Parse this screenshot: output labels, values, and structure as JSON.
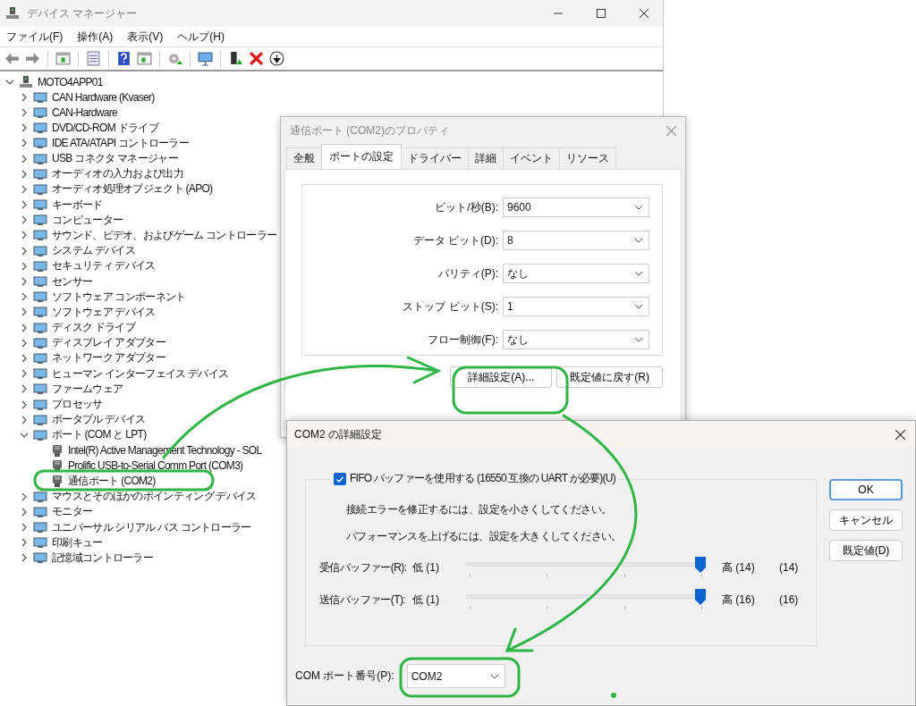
{
  "device_manager": {
    "title": "デバイス マネージャー",
    "menu": [
      "ファイル(F)",
      "操作(A)",
      "表示(V)",
      "ヘルプ(H)"
    ],
    "tree": {
      "label": "MOTO4APP01",
      "expanded": true,
      "children": [
        {
          "label": "CAN Hardware (Kvaser)",
          "expanded": false
        },
        {
          "label": "CAN-Hardware",
          "expanded": false
        },
        {
          "label": "DVD/CD-ROM ドライブ",
          "expanded": false
        },
        {
          "label": "IDE ATA/ATAPI コントローラー",
          "expanded": false
        },
        {
          "label": "USB コネクタ マネージャー",
          "expanded": false
        },
        {
          "label": "オーディオの入力および出力",
          "expanded": false
        },
        {
          "label": "オーディオ処理オブジェクト (APO)",
          "expanded": false
        },
        {
          "label": "キーボード",
          "expanded": false
        },
        {
          "label": "コンピューター",
          "expanded": false
        },
        {
          "label": "サウンド、ビデオ、およびゲーム コントローラー",
          "expanded": false
        },
        {
          "label": "システム デバイス",
          "expanded": false
        },
        {
          "label": "セキュリティ デバイス",
          "expanded": false
        },
        {
          "label": "センサー",
          "expanded": false
        },
        {
          "label": "ソフトウェア コンポーネント",
          "expanded": false
        },
        {
          "label": "ソフトウェア デバイス",
          "expanded": false
        },
        {
          "label": "ディスク ドライブ",
          "expanded": false
        },
        {
          "label": "ディスプレイ アダプター",
          "expanded": false
        },
        {
          "label": "ネットワーク アダプター",
          "expanded": false
        },
        {
          "label": "ヒューマン インターフェイス デバイス",
          "expanded": false
        },
        {
          "label": "ファームウェア",
          "expanded": false
        },
        {
          "label": "プロセッサ",
          "expanded": false
        },
        {
          "label": "ポータブル デバイス",
          "expanded": false
        },
        {
          "label": "ポート (COM と LPT)",
          "expanded": true,
          "children": [
            {
              "label": "Intel(R) Active Management Technology - SOL"
            },
            {
              "label": "Prolific USB-to-Serial Comm Port (COM3)"
            },
            {
              "label": "通信ポート (COM2)"
            }
          ]
        },
        {
          "label": "マウスとそのほかのポインティング デバイス",
          "expanded": false
        },
        {
          "label": "モニター",
          "expanded": false
        },
        {
          "label": "ユニバーサル シリアル バス コントローラー",
          "expanded": false
        },
        {
          "label": "印刷キュー",
          "expanded": false
        },
        {
          "label": "記憶域コントローラー",
          "expanded": false
        }
      ]
    }
  },
  "properties": {
    "title": "通信ポート (COM2)のプロパティ",
    "tabs": [
      {
        "label": "全般",
        "selected": false
      },
      {
        "label": "ポートの設定",
        "selected": true
      },
      {
        "label": "ドライバー",
        "selected": false
      },
      {
        "label": "詳細",
        "selected": false
      },
      {
        "label": "イベント",
        "selected": false
      },
      {
        "label": "リソース",
        "selected": false
      }
    ],
    "settings": [
      {
        "label": "ビット/秒(B):",
        "value": "9600"
      },
      {
        "label": "データ ビット(D):",
        "value": "8"
      },
      {
        "label": "パリティ(P):",
        "value": "なし"
      },
      {
        "label": "ストップ ビット(S):",
        "value": "1"
      },
      {
        "label": "フロー制御(F):",
        "value": "なし"
      }
    ],
    "buttons": [
      "詳細設定(A)...",
      "既定値に戻す(R)"
    ]
  },
  "advanced": {
    "title": "COM2 の詳細設定",
    "fifo": {
      "label": "FIFO バッファーを使用する (16550 互換の UART が必要)(U)",
      "checked": true
    },
    "hints": [
      "接続エラーを修正するには、設定を小さくしてください。",
      "パフォーマンスを上げるには、設定を大きくしてください。"
    ],
    "buffers": [
      {
        "label": "受信バッファー(R):",
        "low": "低 (1)",
        "high": "高 (14)",
        "reading": "(14)",
        "level": 1
      },
      {
        "label": "送信バッファー(T):",
        "low": "低 (1)",
        "high": "高 (16)",
        "reading": "(16)",
        "level": 1
      }
    ],
    "com_port": {
      "label": "COM ポート番号(P):",
      "value": "COM2"
    },
    "buttons": [
      {
        "label": "OK",
        "kind": "default"
      },
      {
        "label": "キャンセル",
        "kind": "normal"
      },
      {
        "label": "既定値(D)",
        "kind": "normal"
      }
    ]
  }
}
